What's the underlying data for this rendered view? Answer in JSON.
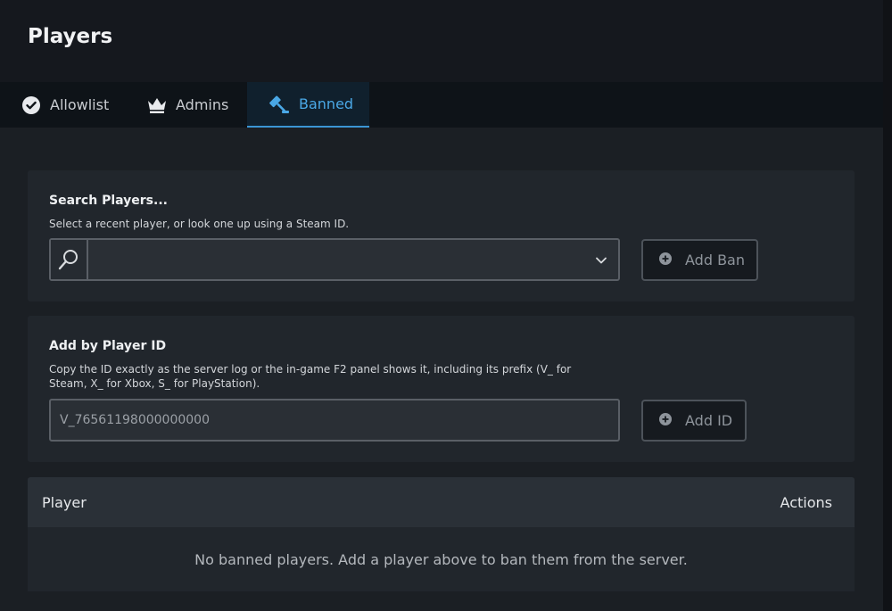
{
  "page": {
    "title": "Players"
  },
  "tabs": [
    {
      "label": "Allowlist",
      "icon": "check-circle-icon",
      "active": false
    },
    {
      "label": "Admins",
      "icon": "crown-icon",
      "active": false
    },
    {
      "label": "Banned",
      "icon": "gavel-icon",
      "active": true
    }
  ],
  "search_card": {
    "title": "Search Players...",
    "description": "Select a recent player, or look one up using a Steam ID.",
    "select_value": "",
    "button_label": "Add Ban"
  },
  "id_card": {
    "title": "Add by Player ID",
    "description": "Copy the ID exactly as the server log or the in-game F2 panel shows it, including its prefix (V_ for Steam, X_ for Xbox, S_ for PlayStation).",
    "input_placeholder": "V_76561198000000000",
    "button_label": "Add ID"
  },
  "table": {
    "columns": [
      "Player",
      "Actions"
    ],
    "empty_message": "No banned players. Add a player above to ban them from the server."
  },
  "colors": {
    "accent": "#4aa8e6",
    "background": "#1b1f24",
    "card": "#21262c"
  }
}
